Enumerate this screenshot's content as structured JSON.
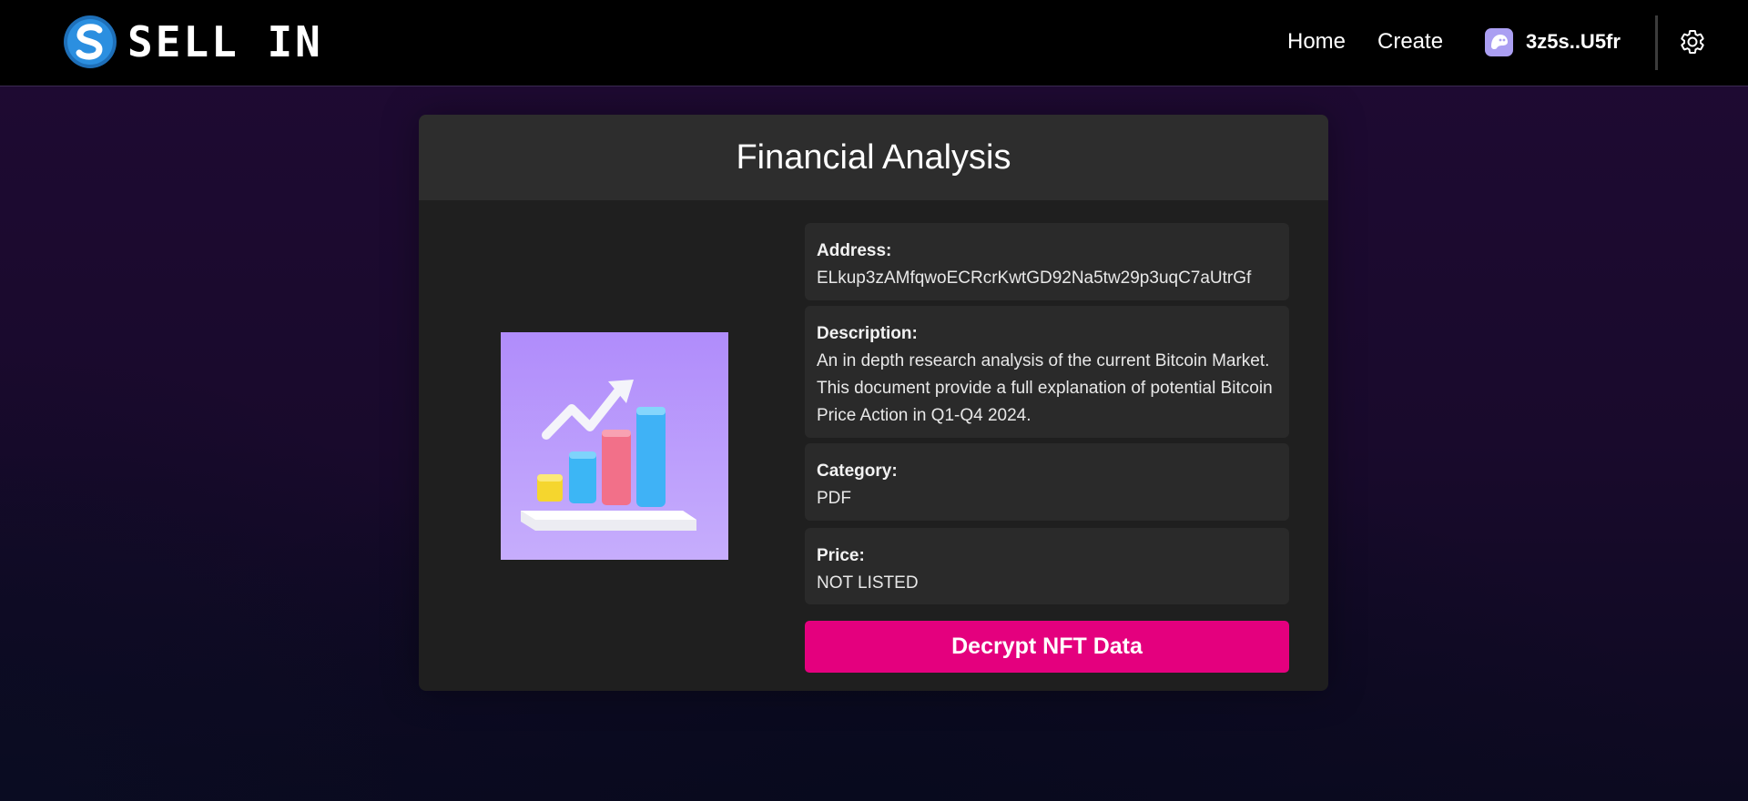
{
  "header": {
    "brand": "SELL IN",
    "nav": [
      {
        "label": "Home"
      },
      {
        "label": "Create"
      }
    ],
    "wallet": {
      "label": "3z5s..U5fr",
      "icon": "phantom-ghost-icon"
    },
    "settings_icon": "gear-icon",
    "logo_icon": "sellin-logo-icon"
  },
  "card": {
    "title": "Financial Analysis",
    "image_icon": "bar-chart-growth-icon",
    "fields": {
      "address": {
        "label": "Address:",
        "value": "ELkup3zAMfqwoECRcrKwtGD92Na5tw29p3uqC7aUtrGf"
      },
      "description": {
        "label": "Description:",
        "value": "An in depth research analysis of the current Bitcoin Market. This document provide a full explanation of potential Bitcoin Price Action in Q1-Q4 2024."
      },
      "category": {
        "label": "Category:",
        "value": "PDF"
      },
      "price": {
        "label": "Price:",
        "value": "NOT LISTED"
      }
    },
    "action_label": "Decrypt NFT Data"
  },
  "colors": {
    "topbar": "#000000",
    "card": "#1f1f1f",
    "card_header": "#2d2d2d",
    "info_box": "#2a2a2a",
    "accent": "#e4007e",
    "wallet_icon": "#ab9ff2",
    "thumbnail_bg": "#b696fb"
  }
}
